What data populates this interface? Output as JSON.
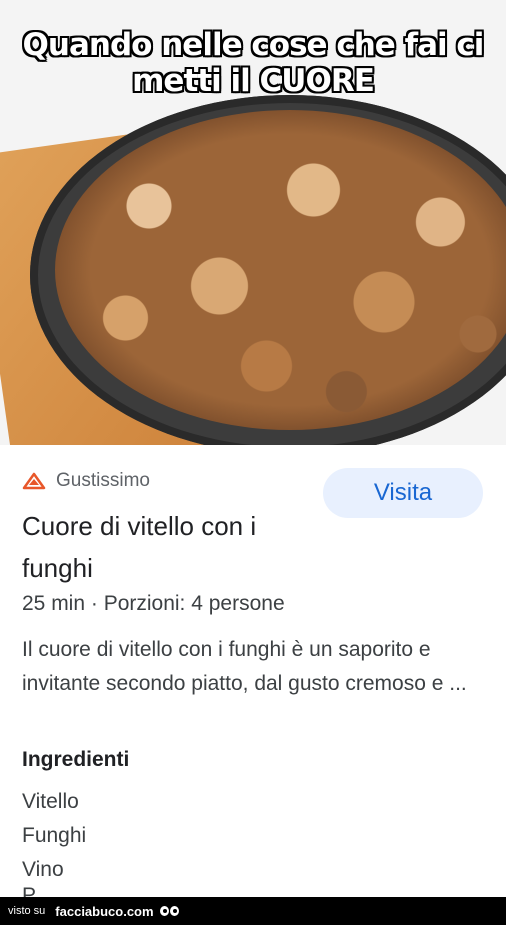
{
  "meme": {
    "line1": "Quando nelle cose che fai ci",
    "line2": "metti il CUORE"
  },
  "card": {
    "source_icon": "recipe-logo-icon",
    "source_name": "Gustissimo",
    "visit_label": "Visita",
    "title": "Cuore di vitello con i funghi",
    "meta": "25 min · Porzioni: 4 persone",
    "description": "Il cuore di vitello con i funghi è un saporito e invitante secondo piatto, dal gusto cremoso e ...",
    "ingredients_heading": "Ingredienti",
    "ingredients": [
      "Vitello",
      "Funghi",
      "Vino"
    ],
    "ingredient_partial": "P"
  },
  "footer": {
    "prefix": "visto su",
    "site": "facciabuco.com",
    "logo_icon": "eyes-icon"
  },
  "colors": {
    "accent": "#1967d2",
    "button_bg": "#e8f0fe",
    "source_icon": "#e8572a"
  }
}
